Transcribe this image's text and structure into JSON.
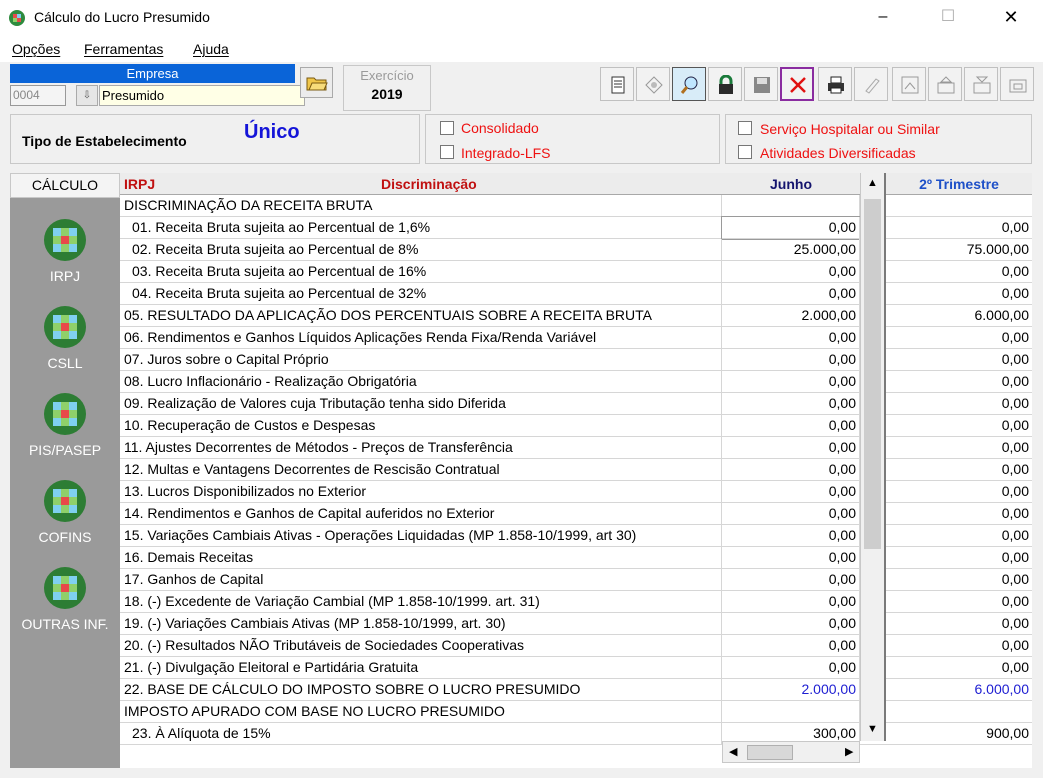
{
  "window": {
    "title": "Cálculo do Lucro Presumido",
    "min": "–",
    "max": "☐",
    "close": "✕"
  },
  "menu": [
    {
      "label": "Opções"
    },
    {
      "label": "Ferramentas"
    },
    {
      "label": "Ajuda"
    }
  ],
  "empresa": {
    "header": "Empresa",
    "code": "0004",
    "name": "Presumido"
  },
  "exercicio": {
    "label": "Exercício",
    "year": "2019"
  },
  "toolbar": [
    "document-icon",
    "diamond-icon",
    "search-icon",
    "lock-icon",
    "save-icon",
    "delete-icon",
    "print-icon",
    "pen-icon",
    "calc-icon",
    "export-icon",
    "import-icon",
    "folder-sync-icon"
  ],
  "estabelecimento": {
    "label": "Tipo de Estabelecimento",
    "value": "Único"
  },
  "options_left": [
    {
      "label": "Consolidado",
      "checked": false
    },
    {
      "label": "Integrado-LFS",
      "checked": false
    }
  ],
  "options_right": [
    {
      "label": "Serviço Hospitalar ou Similar",
      "checked": false
    },
    {
      "label": "Atividades Diversificadas",
      "checked": false
    }
  ],
  "sidebar": {
    "header": "CÁLCULO",
    "items": [
      {
        "label": "IRPJ"
      },
      {
        "label": "CSLL"
      },
      {
        "label": "PIS/PASEP"
      },
      {
        "label": "COFINS"
      },
      {
        "label": "OUTRAS INF."
      }
    ]
  },
  "grid": {
    "header_left": "IRPJ",
    "header_desc": "Discriminação",
    "header_col1": "Junho",
    "header_col2": "2º Trimestre",
    "rows": [
      {
        "desc": "DISCRIMINAÇÃO DA RECEITA BRUTA",
        "v1": "",
        "v2": ""
      },
      {
        "desc": "01. Receita Bruta sujeita ao Percentual de 1,6%",
        "v1": "0,00",
        "v2": "0,00"
      },
      {
        "desc": "02. Receita Bruta sujeita ao Percentual de 8%",
        "v1": "25.000,00",
        "v2": "75.000,00"
      },
      {
        "desc": "03. Receita Bruta sujeita ao Percentual de 16%",
        "v1": "0,00",
        "v2": "0,00"
      },
      {
        "desc": "04. Receita Bruta sujeita ao Percentual de 32%",
        "v1": "0,00",
        "v2": "0,00"
      },
      {
        "desc": "05. RESULTADO DA APLICAÇÃO DOS PERCENTUAIS SOBRE A RECEITA BRUTA",
        "v1": "2.000,00",
        "v2": "6.000,00"
      },
      {
        "desc": "06. Rendimentos e Ganhos Líquidos Aplicações Renda Fixa/Renda Variável",
        "v1": "0,00",
        "v2": "0,00"
      },
      {
        "desc": "07. Juros sobre o Capital Próprio",
        "v1": "0,00",
        "v2": "0,00"
      },
      {
        "desc": "08. Lucro Inflacionário - Realização Obrigatória",
        "v1": "0,00",
        "v2": "0,00"
      },
      {
        "desc": "09. Realização de Valores cuja Tributação tenha sido Diferida",
        "v1": "0,00",
        "v2": "0,00"
      },
      {
        "desc": "10. Recuperação de Custos e Despesas",
        "v1": "0,00",
        "v2": "0,00"
      },
      {
        "desc": "11. Ajustes Decorrentes de Métodos - Preços de Transferência",
        "v1": "0,00",
        "v2": "0,00"
      },
      {
        "desc": "12. Multas e Vantagens Decorrentes de Rescisão Contratual",
        "v1": "0,00",
        "v2": "0,00"
      },
      {
        "desc": "13. Lucros Disponibilizados no Exterior",
        "v1": "0,00",
        "v2": "0,00"
      },
      {
        "desc": "14. Rendimentos e Ganhos de Capital auferidos no Exterior",
        "v1": "0,00",
        "v2": "0,00"
      },
      {
        "desc": "15. Variações Cambiais Ativas - Operações Liquidadas (MP 1.858-10/1999, art 30)",
        "v1": "0,00",
        "v2": "0,00"
      },
      {
        "desc": "16. Demais Receitas",
        "v1": "0,00",
        "v2": "0,00"
      },
      {
        "desc": "17. Ganhos de Capital",
        "v1": "0,00",
        "v2": "0,00"
      },
      {
        "desc": "18. (-) Excedente de Variação Cambial (MP 1.858-10/1999. art. 31)",
        "v1": "0,00",
        "v2": "0,00"
      },
      {
        "desc": "19. (-) Variações Cambiais Ativas (MP 1.858-10/1999, art. 30)",
        "v1": "0,00",
        "v2": "0,00"
      },
      {
        "desc": "20. (-) Resultados NÃO Tributáveis de Sociedades Cooperativas",
        "v1": "0,00",
        "v2": "0,00"
      },
      {
        "desc": "21. (-) Divulgação Eleitoral e Partidária Gratuita",
        "v1": "0,00",
        "v2": "0,00"
      },
      {
        "desc": "22. BASE DE CÁLCULO DO IMPOSTO SOBRE O LUCRO PRESUMIDO",
        "v1": "2.000,00",
        "v2": "6.000,00"
      },
      {
        "desc": "IMPOSTO APURADO COM BASE NO LUCRO PRESUMIDO",
        "v1": "",
        "v2": ""
      },
      {
        "desc": "23. À Alíquota de 15%",
        "v1": "300,00",
        "v2": "900,00"
      }
    ]
  }
}
